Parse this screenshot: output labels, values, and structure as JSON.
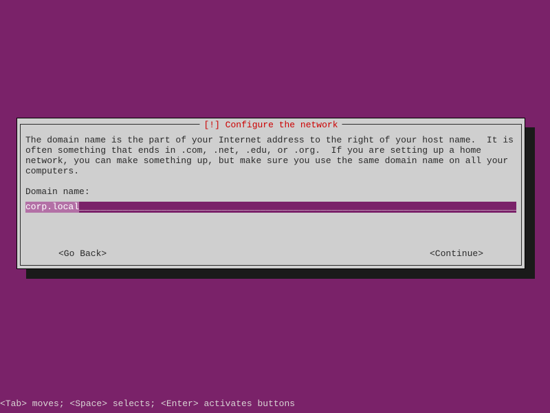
{
  "dialog": {
    "title": "[!] Configure the network",
    "description": "The domain name is the part of your Internet address to the right of your host name.  It is often something that ends in .com, .net, .edu, or .org.  If you are setting up a home network, you can make something up, but make sure you use the same domain name on all your computers.",
    "field_label": "Domain name:",
    "input_value": "corp.local",
    "go_back": "<Go Back>",
    "continue": "<Continue>"
  },
  "helpbar": "<Tab> moves; <Space> selects; <Enter> activates buttons"
}
